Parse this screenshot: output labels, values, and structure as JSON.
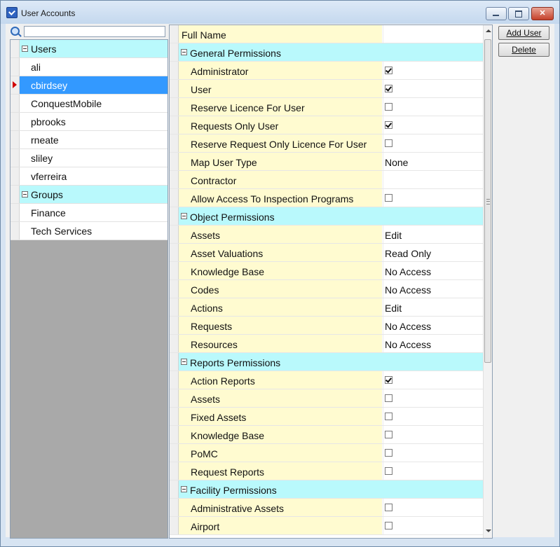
{
  "window": {
    "title": "User Accounts"
  },
  "search": {
    "value": "",
    "placeholder": ""
  },
  "tree": [
    {
      "type": "group",
      "label": "Users"
    },
    {
      "type": "item",
      "label": "ali"
    },
    {
      "type": "item",
      "label": "cbirdsey",
      "selected": true
    },
    {
      "type": "item",
      "label": "ConquestMobile"
    },
    {
      "type": "item",
      "label": "pbrooks"
    },
    {
      "type": "item",
      "label": "rneate"
    },
    {
      "type": "item",
      "label": "sliley"
    },
    {
      "type": "item",
      "label": "vferreira"
    },
    {
      "type": "group",
      "label": "Groups"
    },
    {
      "type": "item",
      "label": "Finance"
    },
    {
      "type": "item",
      "label": "Tech Services"
    }
  ],
  "properties": [
    {
      "type": "header",
      "label": "Full Name",
      "value": ""
    },
    {
      "type": "category",
      "label": "General Permissions"
    },
    {
      "type": "check",
      "label": "Administrator",
      "checked": true
    },
    {
      "type": "check",
      "label": "User",
      "checked": true
    },
    {
      "type": "check",
      "label": "Reserve Licence For User",
      "checked": false
    },
    {
      "type": "check",
      "label": "Requests Only User",
      "checked": true
    },
    {
      "type": "check",
      "label": "Reserve Request Only Licence For User",
      "checked": false
    },
    {
      "type": "text",
      "label": "Map User Type",
      "value": "None"
    },
    {
      "type": "text",
      "label": "Contractor",
      "value": ""
    },
    {
      "type": "check",
      "label": "Allow Access To Inspection Programs",
      "checked": false
    },
    {
      "type": "category",
      "label": "Object Permissions"
    },
    {
      "type": "text",
      "label": "Assets",
      "value": "Edit"
    },
    {
      "type": "text",
      "label": "Asset Valuations",
      "value": "Read Only"
    },
    {
      "type": "text",
      "label": "Knowledge Base",
      "value": "No Access"
    },
    {
      "type": "text",
      "label": "Codes",
      "value": "No Access"
    },
    {
      "type": "text",
      "label": "Actions",
      "value": "Edit"
    },
    {
      "type": "text",
      "label": "Requests",
      "value": "No Access"
    },
    {
      "type": "text",
      "label": "Resources",
      "value": "No Access"
    },
    {
      "type": "category",
      "label": "Reports Permissions"
    },
    {
      "type": "check",
      "label": "Action Reports",
      "checked": true
    },
    {
      "type": "check",
      "label": "Assets",
      "checked": false
    },
    {
      "type": "check",
      "label": "Fixed Assets",
      "checked": false
    },
    {
      "type": "check",
      "label": "Knowledge Base",
      "checked": false
    },
    {
      "type": "check",
      "label": "PoMC",
      "checked": false
    },
    {
      "type": "check",
      "label": "Request Reports",
      "checked": false
    },
    {
      "type": "category",
      "label": "Facility Permissions"
    },
    {
      "type": "check",
      "label": "Administrative Assets",
      "checked": false
    },
    {
      "type": "check",
      "label": "Airport",
      "checked": false
    }
  ],
  "buttons": {
    "add_user": "Add User",
    "delete": "Delete"
  },
  "icons": {
    "app": "user-accounts-app-icon",
    "search": "search-icon",
    "minimize": "minimize-icon",
    "maximize": "maximize-icon",
    "close": "close-icon"
  },
  "colors": {
    "selection": "#3399ff",
    "category_row": "#b9f9fc",
    "name_column": "#fffbd0",
    "row_indicator": "#d10000"
  }
}
